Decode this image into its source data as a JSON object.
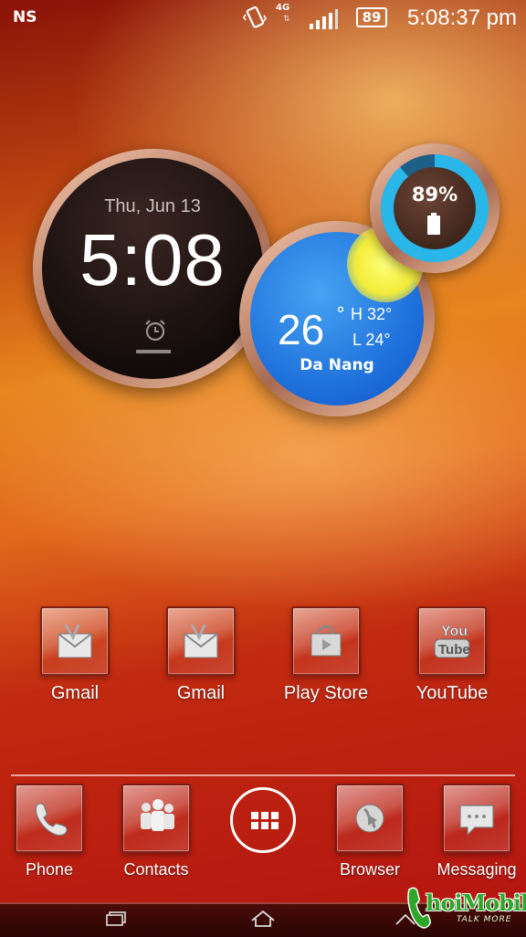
{
  "status_bar": {
    "carrier": "NS",
    "network_type": "4G",
    "battery_level": "89",
    "time": "5:08:37 pm",
    "icons": [
      "vibrate-icon",
      "signal-icon",
      "battery-icon"
    ]
  },
  "clock_widget": {
    "date": "Thu, Jun 13",
    "time": "5:08",
    "icon": "alarm-clock-icon"
  },
  "weather_widget": {
    "temperature": "26",
    "degree_symbol": "°",
    "high": "H 32°",
    "low": "L 24°",
    "city": "Da Nang",
    "icon": "sun-icon"
  },
  "battery_widget": {
    "percent_text": "89%",
    "level": 0.89,
    "color": "#29b6e8",
    "icon": "battery-icon"
  },
  "apps": [
    {
      "label": "Gmail",
      "icon": "gmail-icon"
    },
    {
      "label": "Gmail",
      "icon": "gmail-icon"
    },
    {
      "label": "Play Store",
      "icon": "play-store-icon"
    },
    {
      "label": "YouTube",
      "icon": "youtube-icon"
    }
  ],
  "dock": [
    {
      "label": "Phone",
      "icon": "phone-icon"
    },
    {
      "label": "Contacts",
      "icon": "contacts-icon"
    },
    {
      "label": "",
      "icon": "app-drawer-icon"
    },
    {
      "label": "Browser",
      "icon": "browser-icon"
    },
    {
      "label": "Messaging",
      "icon": "messaging-icon"
    }
  ],
  "nav_bar": {
    "icons": [
      "recent-apps-icon",
      "home-icon",
      "back-icon"
    ]
  },
  "watermark": {
    "brand": "hoiMobile",
    "slogan": "TALK MORE"
  },
  "colors": {
    "wallpaper_top": "#8a1208",
    "wallpaper_mid": "#e7861e",
    "wallpaper_bottom": "#b31410",
    "weather_blue": "#1a6ad8",
    "ring_copper": "#a86a52"
  }
}
